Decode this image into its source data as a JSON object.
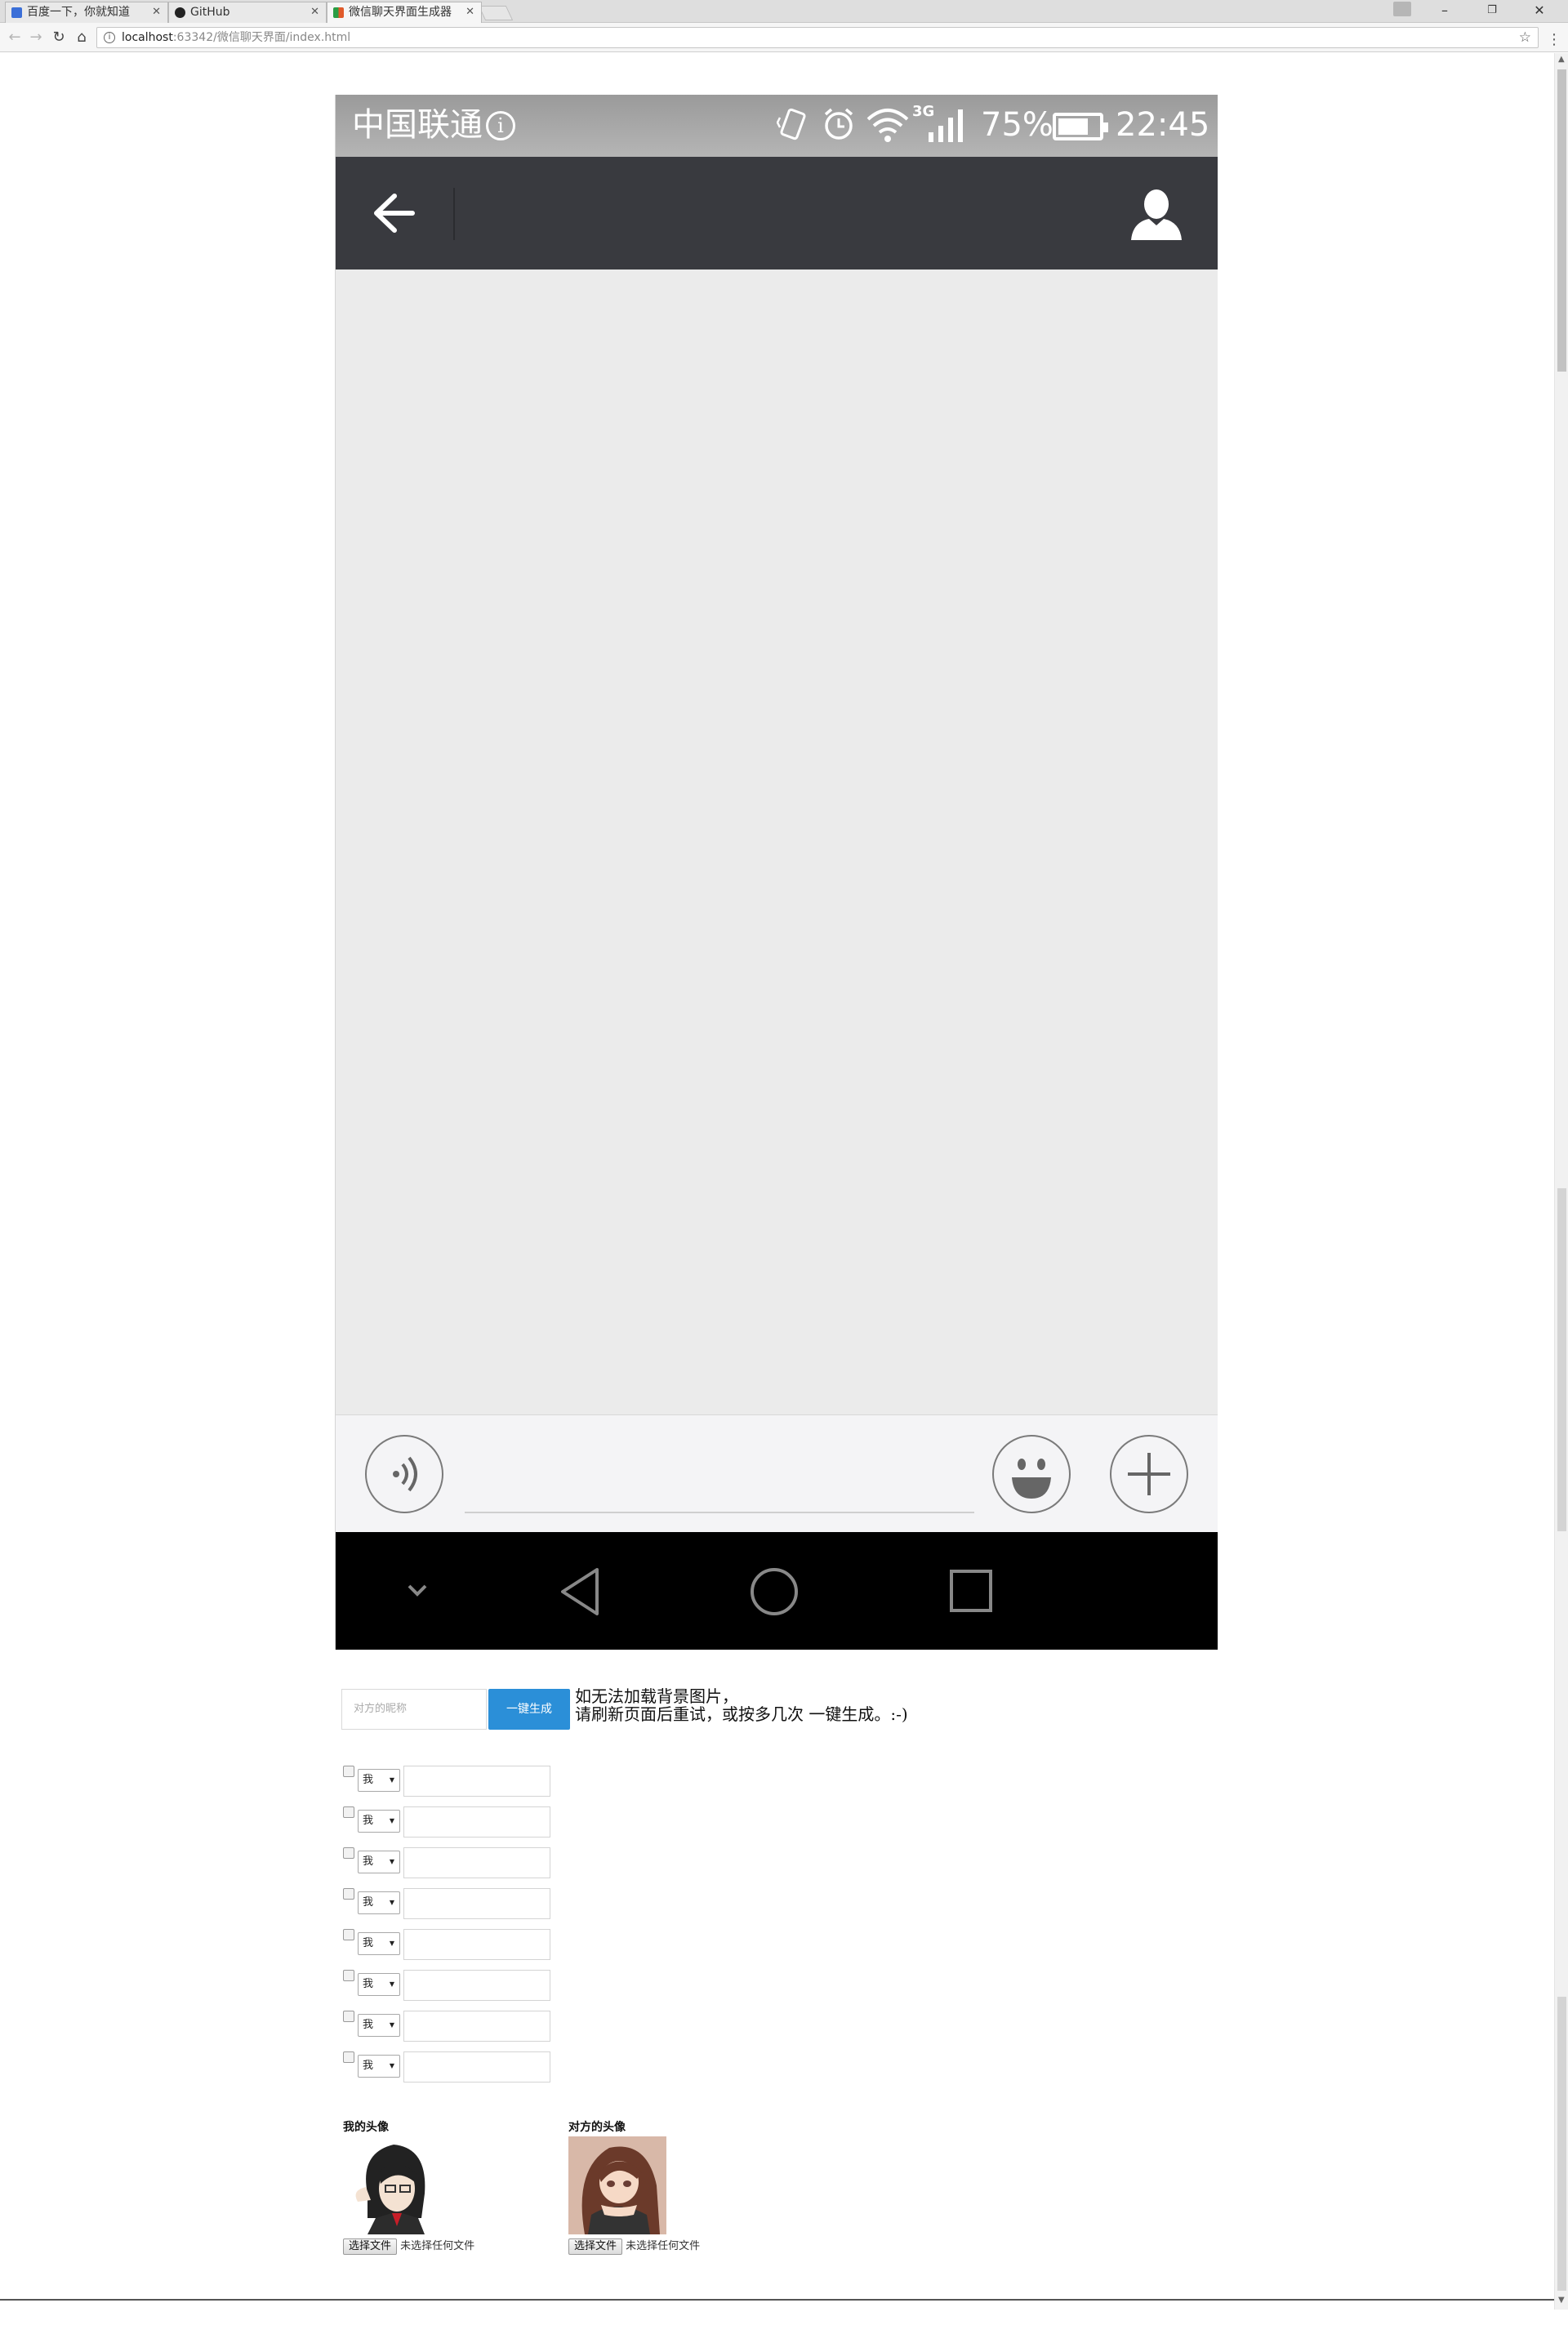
{
  "browser": {
    "tabs": [
      {
        "title": "百度一下，你就知道"
      },
      {
        "title": "GitHub"
      },
      {
        "title": "微信聊天界面生成器"
      }
    ],
    "url_host": "localhost",
    "url_path": ":63342/微信聊天界面/index.html",
    "window_controls": {
      "minimize": "–",
      "restore": "❐",
      "close": "✕"
    }
  },
  "phone": {
    "status": {
      "carrier": "中国联通",
      "network": "3G",
      "battery": "75%",
      "battery_level": 0.75,
      "time": "22:45"
    },
    "colors": {
      "titlebar": "#393a3f",
      "chat_bg": "#ebebeb",
      "button": "#2b8fd8"
    }
  },
  "form": {
    "nickname_placeholder": "对方的昵称",
    "generate_button": "一键生成",
    "note_line1": "如无法加载背景图片，",
    "note_line2": "请刷新页面后重试，或按多几次 一键生成。:-)",
    "rows": [
      {
        "speaker": "我"
      },
      {
        "speaker": "我"
      },
      {
        "speaker": "我"
      },
      {
        "speaker": "我"
      },
      {
        "speaker": "我"
      },
      {
        "speaker": "我"
      },
      {
        "speaker": "我"
      },
      {
        "speaker": "我"
      }
    ],
    "my_avatar_label": "我的头像",
    "their_avatar_label": "对方的头像",
    "choose_file": "选择文件",
    "no_file": "未选择任何文件"
  }
}
